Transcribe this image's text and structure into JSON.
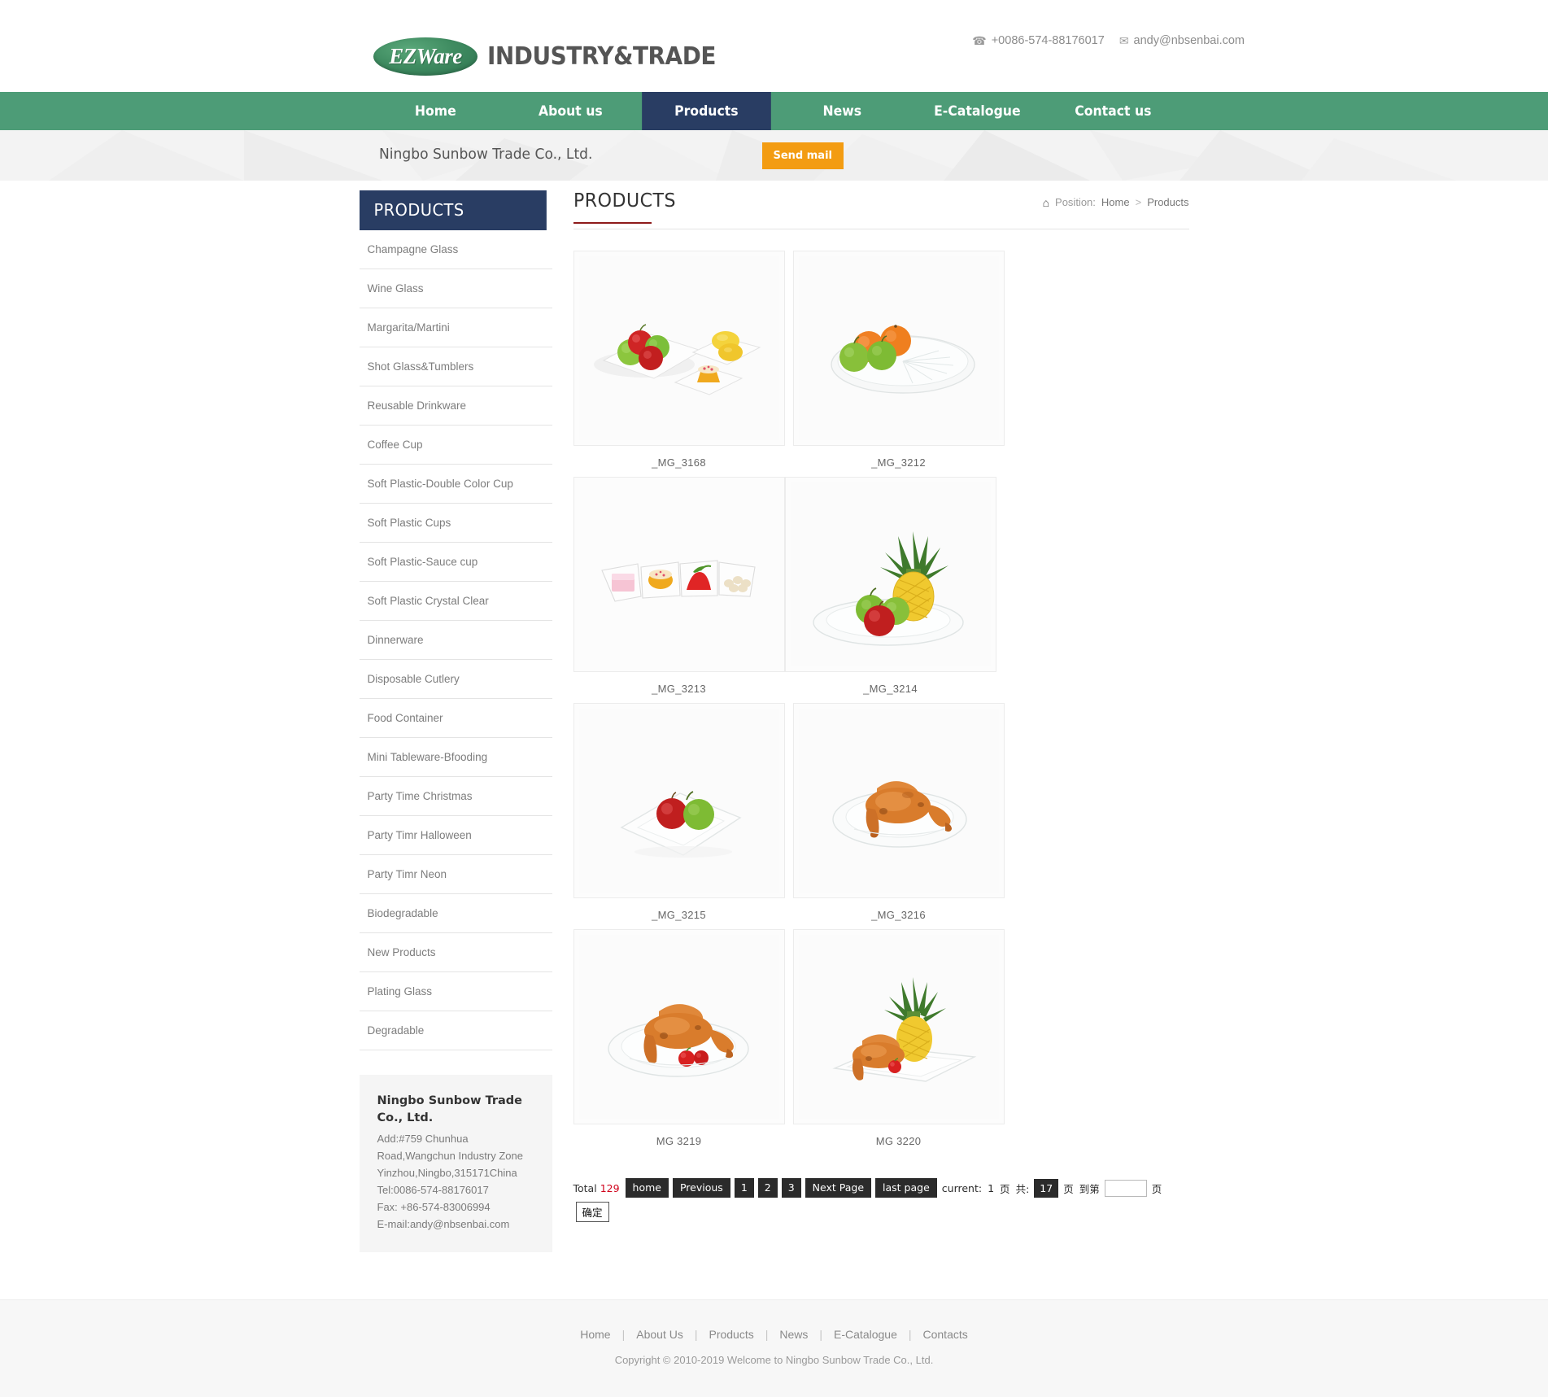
{
  "header": {
    "logo_badge": "EZWare",
    "logo_text": "INDUSTRY&TRADE",
    "phone": "+0086-574-88176017",
    "email": "andy@nbsenbai.com",
    "phone_icon": "telephone-icon",
    "mail_icon": "envelope-icon"
  },
  "nav": {
    "items": [
      {
        "label": "Home",
        "active": false
      },
      {
        "label": "About us",
        "active": false
      },
      {
        "label": "Products",
        "active": true
      },
      {
        "label": "News",
        "active": false
      },
      {
        "label": "E-Catalogue",
        "active": false
      },
      {
        "label": "Contact us",
        "active": false
      }
    ]
  },
  "banner": {
    "title": "Ningbo Sunbow Trade Co., Ltd.",
    "send_mail_label": "Send mail",
    "accent_color": "#f39c12"
  },
  "sidebar": {
    "heading": "PRODUCTS",
    "heading_bg": "#293d63",
    "categories": [
      "Champagne Glass",
      "Wine Glass",
      "Margarita/Martini",
      "Shot Glass&Tumblers",
      "Reusable Drinkware",
      "Coffee Cup",
      "Soft Plastic-Double Color Cup",
      "Soft Plastic Cups",
      "Soft Plastic-Sauce cup",
      "Soft Plastic Crystal Clear",
      "Dinnerware",
      "Disposable Cutlery",
      "Food Container",
      "Mini Tableware-Bfooding",
      "Party Time Christmas",
      "Party Timr Halloween",
      "Party Timr Neon",
      "Biodegradable",
      "New Products",
      "Plating Glass",
      "Degradable"
    ],
    "address_box": {
      "company": "Ningbo Sunbow Trade Co., Ltd.",
      "lines": [
        "Add:#759 Chunhua",
        "Road,Wangchun Industry Zone",
        "Yinzhou,Ningbo,315171China",
        "Tel:0086-574-88176017",
        "Fax: +86-574-83006994",
        "E-mail:andy@nbsenbai.com"
      ]
    }
  },
  "main": {
    "title": "PRODUCTS",
    "title_underline_color": "#8e1b1b",
    "breadcrumb": {
      "icon": "home-icon",
      "prefix": "Position:",
      "home": "Home",
      "separator": ">",
      "current": "Products"
    },
    "products": [
      {
        "label": "_MG_3168",
        "art": "square-plates-fruit"
      },
      {
        "label": "_MG_3212",
        "art": "round-clear-plate-fruit"
      },
      {
        "label": "_MG_3213",
        "art": "four-compartment-tray"
      },
      {
        "label": "_MG_3214",
        "art": "pineapple-plate"
      },
      {
        "label": "_MG_3215",
        "art": "square-plate-apples"
      },
      {
        "label": "_MG_3216",
        "art": "roast-chicken-plate"
      },
      {
        "label": "MG  3219",
        "art": "roast-chicken-tomato"
      },
      {
        "label": "MG  3220",
        "art": "chicken-pineapple-tray"
      }
    ],
    "pagination": {
      "total_label": "Total",
      "total_count": "129",
      "home": "home",
      "previous": "Previous",
      "pages": [
        "1",
        "2",
        "3"
      ],
      "next": "Next Page",
      "last": "last page",
      "current_label": "current:",
      "current_page": "1",
      "unit_page": "页",
      "of_label": "共:",
      "total_pages": "17",
      "goto_label": "到第",
      "goto_value": "",
      "confirm": "确定"
    }
  },
  "footer": {
    "links": [
      "Home",
      "About Us",
      "Products",
      "News",
      "E-Catalogue",
      "Contacts"
    ],
    "separator": "|",
    "copyright": "Copyright © 2010-2019 Welcome to Ningbo Sunbow Trade Co., Ltd."
  }
}
